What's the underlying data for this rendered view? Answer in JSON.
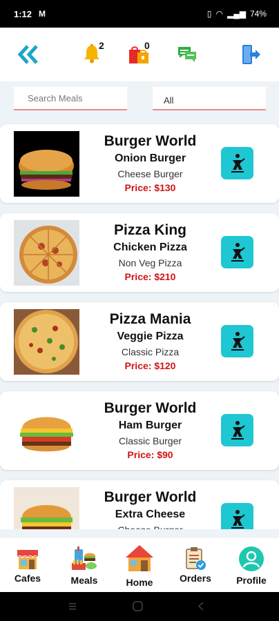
{
  "status_bar": {
    "time": "1:12",
    "battery": "74%"
  },
  "header": {
    "notifications_count": "2",
    "cart_count": "0"
  },
  "search": {
    "placeholder": "Search Meals",
    "filter_value": "All"
  },
  "meals": [
    {
      "cafe": "Burger World",
      "meal": "Onion Burger",
      "category": "Cheese Burger",
      "price": "Price: $130"
    },
    {
      "cafe": "Pizza King",
      "meal": "Chicken Pizza",
      "category": "Non Veg Pizza",
      "price": "Price: $210"
    },
    {
      "cafe": "Pizza Mania",
      "meal": "Veggie Pizza",
      "category": "Classic Pizza",
      "price": "Price: $120"
    },
    {
      "cafe": "Burger World",
      "meal": "Ham Burger",
      "category": "Classic Burger",
      "price": "Price: $90"
    },
    {
      "cafe": "Burger World",
      "meal": "Extra Cheese",
      "category": "Cheese Burger",
      "price": ""
    }
  ],
  "bottom_nav": [
    {
      "label": "Cafes",
      "icon": "cafe-icon"
    },
    {
      "label": "Meals",
      "icon": "meals-icon"
    },
    {
      "label": "Home",
      "icon": "home-icon"
    },
    {
      "label": "Orders",
      "icon": "orders-icon"
    },
    {
      "label": "Profile",
      "icon": "profile-icon"
    }
  ],
  "colors": {
    "accent_cyan": "#1ec7d2",
    "price_red": "#d01414",
    "input_underline": "#e98a8a"
  }
}
